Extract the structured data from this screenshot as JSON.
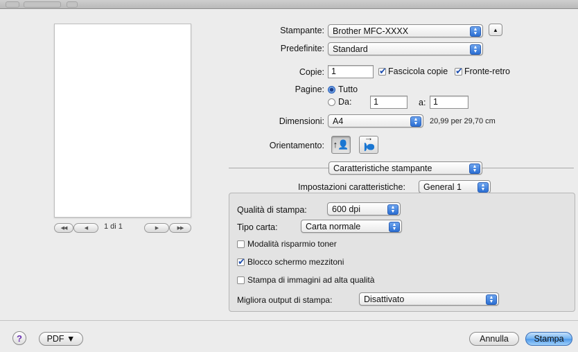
{
  "icons": {
    "help": "?",
    "disclosure": "▲",
    "popup_arrows_up": "▲",
    "popup_arrows_down": "▼",
    "first_page": "◀◀",
    "prev_page": "◀",
    "next_page": "▶",
    "last_page": "▶▶",
    "portrait": "↑👤",
    "landscape": "↑👤"
  },
  "preview": {
    "page_indicator": "1 di 1"
  },
  "printer": {
    "label": "Stampante:",
    "value": "Brother MFC-XXXX"
  },
  "presets": {
    "label": "Predefinite:",
    "value": "Standard"
  },
  "copies": {
    "label": "Copie:",
    "value": "1",
    "collate_label": "Fascicola copie",
    "collate_checked": true,
    "duplex_label": "Fronte-retro",
    "duplex_checked": true
  },
  "pages": {
    "label": "Pagine:",
    "all_label": "Tutto",
    "all_selected": true,
    "from_label": "Da:",
    "from_value": "1",
    "to_label": "a:",
    "to_value": "1"
  },
  "paper_size": {
    "label": "Dimensioni:",
    "value": "A4",
    "dims": "20,99 per 29,70 cm"
  },
  "orientation": {
    "label": "Orientamento:",
    "selected": "portrait"
  },
  "panel_selector": {
    "value": "Caratteristiche stampante"
  },
  "feature_sets": {
    "label": "Impostazioni caratteristiche:",
    "value": "General 1"
  },
  "settings": {
    "print_quality_label": "Qualità di stampa:",
    "print_quality_value": "600 dpi",
    "media_type_label": "Tipo carta:",
    "media_type_value": "Carta normale",
    "toner_save_label": "Modalità risparmio toner",
    "toner_save_checked": false,
    "halftone_lock_label": "Blocco schermo mezzitoni",
    "halftone_lock_checked": true,
    "hq_image_label": "Stampa di immagini ad alta qualità",
    "hq_image_checked": false,
    "improve_output_label": "Migliora output di stampa:",
    "improve_output_value": "Disattivato"
  },
  "footer": {
    "pdf_label": "PDF ▼",
    "cancel_label": "Annulla",
    "print_label": "Stampa"
  },
  "colors": {
    "accent": "#4e9aea",
    "background": "#ececec"
  }
}
